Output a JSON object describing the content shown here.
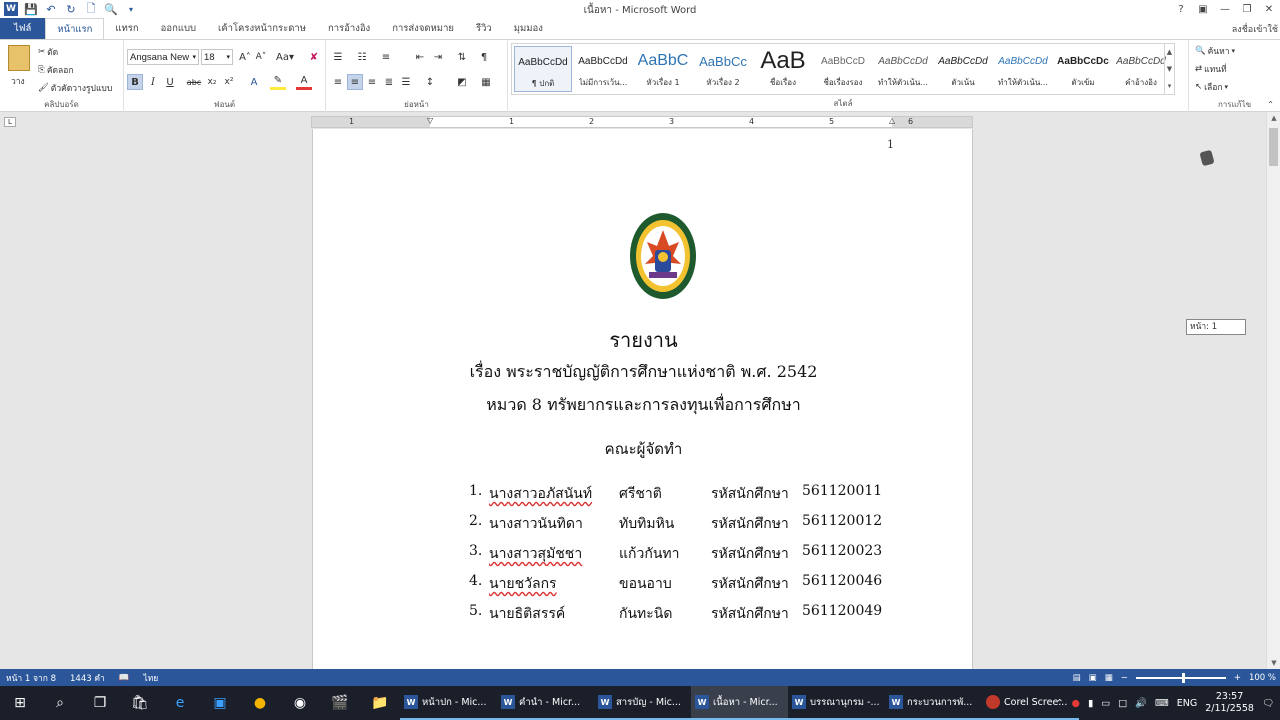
{
  "window": {
    "title": "เนื้อหา - Microsoft Word"
  },
  "ribbon_tabs": [
    "ไฟล์",
    "หน้าแรก",
    "แทรก",
    "ออกแบบ",
    "เค้าโครงหน้ากระดาษ",
    "การอ้างอิง",
    "การส่งจดหมาย",
    "รีวิว",
    "มุมมอง"
  ],
  "signin": "ลงชื่อเข้าใช้",
  "clipboard": {
    "paste": "วาง",
    "cut": "ตัด",
    "copy": "คัดลอก",
    "format_painter": "ตัวคัดวางรูปแบบ",
    "label": "คลิปบอร์ด"
  },
  "font": {
    "name": "Angsana New",
    "size": "18",
    "label": "ฟอนต์"
  },
  "paragraph": {
    "label": "ย่อหน้า"
  },
  "styles": {
    "label": "สไตล์",
    "items": [
      {
        "sample": "AaBbCcDd",
        "name": "¶ ปกติ"
      },
      {
        "sample": "AaBbCcDd",
        "name": "ไม่มีการเว้น..."
      },
      {
        "sample": "AaBbC",
        "name": "หัวเรื่อง 1"
      },
      {
        "sample": "AaBbCc",
        "name": "หัวเรื่อง 2"
      },
      {
        "sample": "AaB",
        "name": "ชื่อเรื่อง"
      },
      {
        "sample": "AaBbCcD",
        "name": "ชื่อเรื่องรอง"
      },
      {
        "sample": "AaBbCcDd",
        "name": "ทำให้ตัวเน้น..."
      },
      {
        "sample": "AaBbCcDd",
        "name": "ตัวเน้น"
      },
      {
        "sample": "AaBbCcDd",
        "name": "ทำให้ตัวเน้น..."
      },
      {
        "sample": "AaBbCcDc",
        "name": "ตัวเข้ม"
      },
      {
        "sample": "AaBbCcDd",
        "name": "คำอ้างอิง"
      }
    ]
  },
  "editing": {
    "find": "ค้นหา",
    "replace": "แทนที่",
    "select": "เลือก",
    "label": "การแก้ไข"
  },
  "ruler": {
    "numbers": [
      "1",
      "1",
      "2",
      "3",
      "4",
      "5",
      "6"
    ]
  },
  "document": {
    "page_number": "1",
    "title": "รายงาน",
    "subject": "เรื่อง  พระราชบัญญัติการศึกษาแห่งชาติ พ.ศ. 2542",
    "chapter": "หมวด 8  ทรัพยากรและการลงทุนเพื่อการศึกษา",
    "team_heading": "คณะผู้จัดทำ",
    "members": [
      {
        "no": "1.",
        "first": "นางสาวอภัสนันท์",
        "last": "ศรีชาติ",
        "id_label": "รหัสนักศึกษา",
        "id": "561120011"
      },
      {
        "no": "2.",
        "first": "นางสาวนันทิดา",
        "last": "ทับทิมหิน",
        "id_label": "รหัสนักศึกษา",
        "id": "561120012"
      },
      {
        "no": "3.",
        "first": "นางสาวสุมัชชา",
        "last": "แก้วกันทา",
        "id_label": "รหัสนักศึกษา",
        "id": "561120023"
      },
      {
        "no": "4.",
        "first": "นายชวัลกร",
        "last": "ขอนอาบ",
        "id_label": "รหัสนักศึกษา",
        "id": "561120046"
      },
      {
        "no": "5.",
        "first": "นายธิติสรรค์",
        "last": "กันทะนิด",
        "id_label": "รหัสนักศึกษา",
        "id": "561120049"
      }
    ]
  },
  "page_tooltip": "หน้า: 1",
  "statusbar": {
    "page": "หน้า 1 จาก 8",
    "words": "1443 คำ",
    "language": "ไทย",
    "zoom": "100 %"
  },
  "taskbar": {
    "apps": [
      {
        "label": "หน้าปก - Mic...",
        "type": "word"
      },
      {
        "label": "คำนำ - Micr...",
        "type": "word"
      },
      {
        "label": "สารบัญ - Mic...",
        "type": "word"
      },
      {
        "label": "เนื้อหา - Micr...",
        "type": "word",
        "active": true
      },
      {
        "label": "บรรณานุกรม -...",
        "type": "word"
      },
      {
        "label": "กระบวนการพั...",
        "type": "word"
      },
      {
        "label": "Corel Scree...",
        "type": "corel"
      }
    ],
    "language": "ENG",
    "time": "23:57",
    "date": "2/11/2558"
  },
  "colors": {
    "word_blue": "#2b579a",
    "taskbar": "#1a1f2a"
  }
}
